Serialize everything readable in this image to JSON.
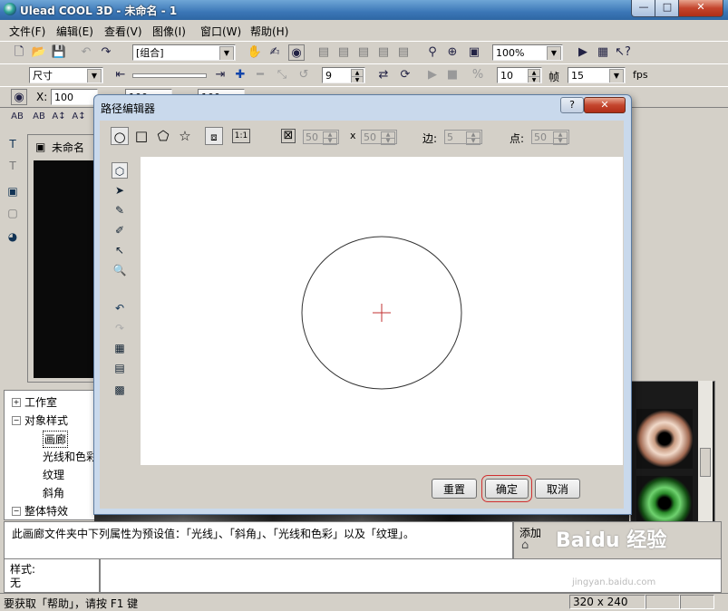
{
  "window": {
    "title": "Ulead COOL 3D - 未命名 - 1",
    "min": "—",
    "max": "□",
    "close": "✕"
  },
  "menu": [
    "文件(F)",
    "编辑(E)",
    "查看(V)",
    "图像(I)",
    "窗口(W)",
    "帮助(H)"
  ],
  "toolbar1": {
    "group_select": "[组合]",
    "zoom": "100%"
  },
  "toolbar2": {
    "size_select": "尺寸",
    "frame_value": "9",
    "frames_total": "10",
    "frame_label": "帧",
    "fps_value": "15",
    "fps_label": "fps"
  },
  "toolbar3": {
    "x_label": "X:",
    "x_value": "100",
    "y_value": "100",
    "z_value": "100"
  },
  "text_tools": [
    "AB",
    "AB",
    "A↕",
    "A↕",
    "AB"
  ],
  "doc": {
    "tab_title": "未命名"
  },
  "tree": [
    {
      "label": "工作室",
      "toggle": "+"
    },
    {
      "label": "对象样式",
      "toggle": "−"
    },
    {
      "label": "画廊",
      "selected": true
    },
    {
      "label": "光线和色彩"
    },
    {
      "label": "纹理"
    },
    {
      "label": "斜角"
    },
    {
      "label": "整体特效",
      "toggle": "−"
    }
  ],
  "description": "此画廊文件夹中下列属性为预设值：「光线」、「斜角」、「光线和色彩」以及「纹理」。",
  "add_panel": {
    "label": "添加"
  },
  "style_panel": {
    "label": "样式:",
    "value": "无"
  },
  "status": {
    "help": "要获取「帮助」，请按 F1 键",
    "size": "320 x 240"
  },
  "dialog": {
    "title": "路径编辑器",
    "help": "?",
    "close": "✕",
    "grid_w": "50",
    "grid_h": "50",
    "x_sep": "x",
    "sides_label": "边:",
    "sides_value": "5",
    "points_label": "点:",
    "points_value": "50",
    "buttons": {
      "reset": "重置",
      "ok": "确定",
      "cancel": "取消"
    }
  },
  "watermark": {
    "text": "Baidu 经验",
    "url": "jingyan.baidu.com"
  },
  "colors": {
    "title_bar": "#3b77b7",
    "dialog_frame": "#c9d9ec",
    "close_red": "#c4452d",
    "path_stroke": "#333333",
    "center_mark": "#c03030"
  }
}
